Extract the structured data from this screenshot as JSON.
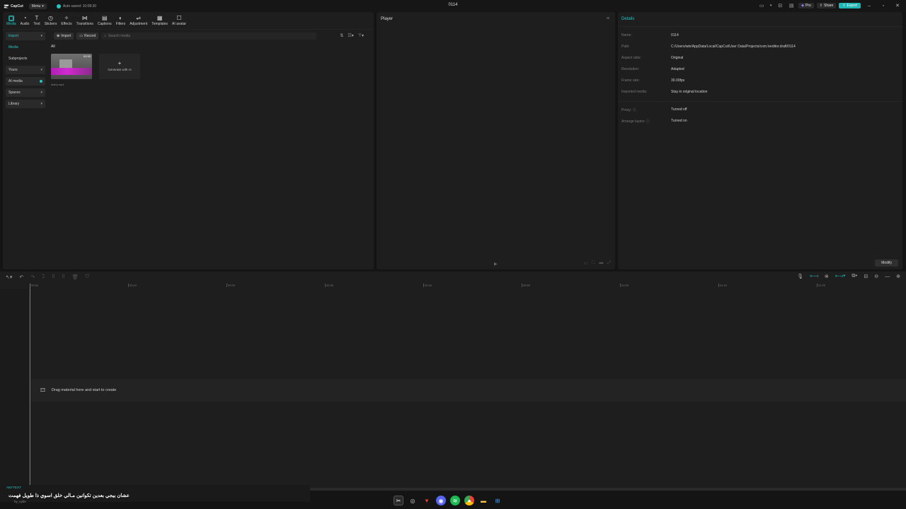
{
  "titlebar": {
    "app_name": "CapCut",
    "menu_label": "Menu",
    "autosave": "Auto saved: 10:08:30",
    "project_title": "0114",
    "pro_label": "Pro",
    "share_label": "Share",
    "export_label": "Export"
  },
  "tools": [
    {
      "label": "Media",
      "icon": "media-icon"
    },
    {
      "label": "Audio",
      "icon": "audio-icon"
    },
    {
      "label": "Text",
      "icon": "text-icon"
    },
    {
      "label": "Stickers",
      "icon": "stickers-icon"
    },
    {
      "label": "Effects",
      "icon": "effects-icon"
    },
    {
      "label": "Transitions",
      "icon": "transitions-icon"
    },
    {
      "label": "Captions",
      "icon": "captions-icon"
    },
    {
      "label": "Filters",
      "icon": "filters-icon"
    },
    {
      "label": "Adjustment",
      "icon": "adjustment-icon"
    },
    {
      "label": "Templates",
      "icon": "templates-icon"
    },
    {
      "label": "AI avatar",
      "icon": "ai-avatar-icon"
    }
  ],
  "sidebar": {
    "import": "Import",
    "media": "Media",
    "subprojects": "Subprojects",
    "yours": "Yours",
    "ai_media": "AI media",
    "spaces": "Spaces",
    "library": "Library"
  },
  "media": {
    "import_btn": "Import",
    "record_btn": "Record",
    "search_placeholder": "Search media",
    "filter_all": "All",
    "clip_duration": "00:30",
    "clip_name": "lesha.mp4",
    "generate_label": "Generate with AI"
  },
  "player": {
    "title": "Player"
  },
  "details": {
    "title": "Details",
    "rows": [
      {
        "key": "Name:",
        "value": "0114"
      },
      {
        "key": "Path:",
        "value": "C:/Users/win/AppData/Local/CapCut/User Data/Projects/com.lveditor.draft/0114"
      },
      {
        "key": "Aspect ratio:",
        "value": "Original"
      },
      {
        "key": "Resolution:",
        "value": "Adapted"
      },
      {
        "key": "Frame rate:",
        "value": "30.00fps"
      },
      {
        "key": "Imported media:",
        "value": "Stay in original location"
      }
    ],
    "rows2": [
      {
        "key": "Proxy:",
        "value": "Turned off"
      },
      {
        "key": "Arrange layers",
        "value": "Turned on"
      }
    ],
    "modify_label": "Modify"
  },
  "timeline": {
    "ticks": [
      "00:00",
      "00:10",
      "00:20",
      "00:30",
      "00:40",
      "00:50",
      "01:00",
      "01:10",
      "01:20"
    ],
    "drop_text": "Drag material here and start to create"
  },
  "overlay": {
    "tag": "ANYTEXT",
    "caption": "عشان بيجي بعدين تكوانين مـالي خلق اسوي ذا طويل فهمت",
    "sub": "by_vybe"
  }
}
